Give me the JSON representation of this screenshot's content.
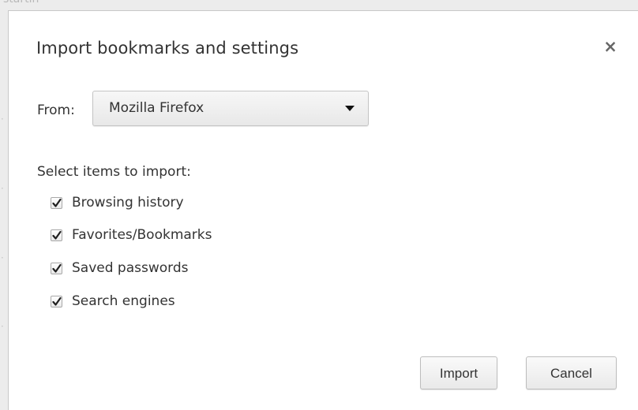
{
  "background": {
    "partial_text": "startin"
  },
  "dialog": {
    "title": "Import bookmarks and settings",
    "close_icon": "close-icon",
    "from_label": "From:",
    "from_select": {
      "value": "Mozilla Firefox",
      "arrow_icon": "dropdown-arrow-icon"
    },
    "items_label": "Select items to import:",
    "items": [
      {
        "label": "Browsing history",
        "checked": true
      },
      {
        "label": "Favorites/Bookmarks",
        "checked": true
      },
      {
        "label": "Saved passwords",
        "checked": true
      },
      {
        "label": "Search engines",
        "checked": true
      }
    ],
    "import_label": "Import",
    "cancel_label": "Cancel"
  },
  "colors": {
    "text": "#333333",
    "button_border": "#bdbdbd",
    "dialog_background": "#ffffff"
  }
}
